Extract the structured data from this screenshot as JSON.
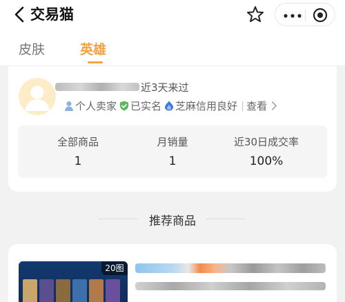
{
  "header": {
    "title": "交易猫",
    "back_icon": "chevron-left-icon",
    "favorite_icon": "star-icon",
    "more_icon": "more-dots-icon",
    "close_icon": "target-circle-icon"
  },
  "tabs": [
    {
      "label": "皮肤",
      "active": false
    },
    {
      "label": "英雄",
      "active": true
    }
  ],
  "accent_color": "#f5a23d",
  "seller": {
    "recent_text": "近3天来过",
    "tags": [
      {
        "label": "个人卖家",
        "icon": "person-icon"
      },
      {
        "label": "已实名",
        "icon": "verified-shield-icon"
      },
      {
        "label": "芝麻信用良好",
        "icon": "sesame-credit-icon"
      }
    ],
    "view_label": "查看"
  },
  "stats": [
    {
      "label": "全部商品",
      "value": "1"
    },
    {
      "label": "月销量",
      "value": "1"
    },
    {
      "label": "近30日成交率",
      "value": "100%"
    }
  ],
  "recommend": {
    "title": "推荐商品"
  },
  "product": {
    "image_count_badge": "20图"
  }
}
